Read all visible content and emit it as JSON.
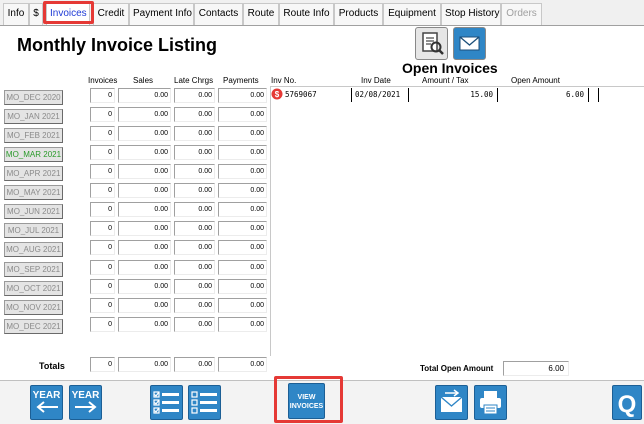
{
  "tabs": [
    {
      "label": "Info"
    },
    {
      "label": "$"
    },
    {
      "label": "Invoices"
    },
    {
      "label": "Credit"
    },
    {
      "label": "Payment Info"
    },
    {
      "label": "Contacts"
    },
    {
      "label": "Route"
    },
    {
      "label": "Route Info"
    },
    {
      "label": "Products"
    },
    {
      "label": "Equipment"
    },
    {
      "label": "Stop History"
    },
    {
      "label": "Orders"
    }
  ],
  "page_title": "Monthly Invoice Listing",
  "open_invoices_title": "Open Invoices",
  "monthly_headers": {
    "invoices": "Invoices",
    "sales": "Sales",
    "late": "Late Chrgs",
    "payments": "Payments"
  },
  "open_headers": {
    "inv_no": "Inv No.",
    "inv_date": "Inv Date",
    "amount_tax": "Amount / Tax",
    "open_amount": "Open Amount"
  },
  "months": [
    {
      "label": "MO_DEC 2020",
      "invoices": "0",
      "sales": "0.00",
      "late": "0.00",
      "payments": "0.00"
    },
    {
      "label": "MO_JAN 2021",
      "invoices": "0",
      "sales": "0.00",
      "late": "0.00",
      "payments": "0.00"
    },
    {
      "label": "MO_FEB 2021",
      "invoices": "0",
      "sales": "0.00",
      "late": "0.00",
      "payments": "0.00"
    },
    {
      "label": "MO_MAR 2021",
      "invoices": "0",
      "sales": "0.00",
      "late": "0.00",
      "payments": "0.00"
    },
    {
      "label": "MO_APR 2021",
      "invoices": "0",
      "sales": "0.00",
      "late": "0.00",
      "payments": "0.00"
    },
    {
      "label": "MO_MAY 2021",
      "invoices": "0",
      "sales": "0.00",
      "late": "0.00",
      "payments": "0.00"
    },
    {
      "label": "MO_JUN 2021",
      "invoices": "0",
      "sales": "0.00",
      "late": "0.00",
      "payments": "0.00"
    },
    {
      "label": "MO_JUL 2021",
      "invoices": "0",
      "sales": "0.00",
      "late": "0.00",
      "payments": "0.00"
    },
    {
      "label": "MO_AUG 2021",
      "invoices": "0",
      "sales": "0.00",
      "late": "0.00",
      "payments": "0.00"
    },
    {
      "label": "MO_SEP 2021",
      "invoices": "0",
      "sales": "0.00",
      "late": "0.00",
      "payments": "0.00"
    },
    {
      "label": "MO_OCT 2021",
      "invoices": "0",
      "sales": "0.00",
      "late": "0.00",
      "payments": "0.00"
    },
    {
      "label": "MO_NOV 2021",
      "invoices": "0",
      "sales": "0.00",
      "late": "0.00",
      "payments": "0.00"
    },
    {
      "label": "MO_DEC 2021",
      "invoices": "0",
      "sales": "0.00",
      "late": "0.00",
      "payments": "0.00"
    }
  ],
  "totals": {
    "label": "Totals",
    "invoices": "0",
    "sales": "0.00",
    "late": "0.00",
    "payments": "0.00"
  },
  "open_invoices": [
    {
      "inv_no": "5769067",
      "inv_date": "02/08/2021",
      "amount": "15.00",
      "open_amount": "6.00"
    }
  ],
  "total_open_amount": {
    "label": "Total Open Amount",
    "value": "6.00"
  },
  "buttons": {
    "year_prev": "YEAR",
    "year_next": "YEAR",
    "view_invoices_line1": "VIEW",
    "view_invoices_line2": "INVOICES"
  },
  "colors": {
    "accent_tab": "#1f3bd6",
    "highlight": "#e53935",
    "button_blue": "#2f86c6",
    "current_month": "#2a9a2a"
  },
  "icons": [
    "search-document-icon",
    "email-icon",
    "arrow-left-icon",
    "arrow-right-icon",
    "checklist-icon",
    "list-icon",
    "send-email-icon",
    "print-icon",
    "quick-search-icon",
    "dollar-icon"
  ]
}
